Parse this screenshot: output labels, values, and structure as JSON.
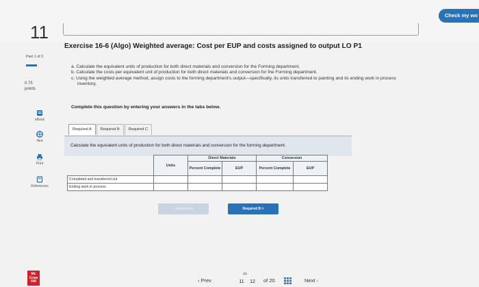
{
  "question": {
    "number": "11"
  },
  "header": {
    "check_button": "Check my wo"
  },
  "sidebar": {
    "part": "Part 1 of 2",
    "points_value": "0.75",
    "points_label": "points",
    "items": [
      {
        "label": "eBook",
        "icon": "book-icon"
      },
      {
        "label": "Hint",
        "icon": "hint-icon"
      },
      {
        "label": "Print",
        "icon": "print-icon"
      },
      {
        "label": "References",
        "icon": "references-icon"
      }
    ],
    "logo": {
      "line1": "Mc",
      "line2": "Graw",
      "line3": "Hill"
    }
  },
  "exercise": {
    "title": "Exercise 16-6 (Algo) Weighted average: Cost per EUP and costs assigned to output LO P1",
    "instructions": [
      {
        "letter": "a.",
        "text": "Calculate the equivalent units of production for both direct materials and conversion for the Forming department."
      },
      {
        "letter": "b.",
        "text": "Calculate the costs per equivalent unit of production for both direct materials and conversion for the Forming department."
      },
      {
        "letter": "c.",
        "text": "Using the weighted average method, assign costs to the forming department's output—specifically, its units transferred to painting and its ending work in process inventory."
      }
    ],
    "complete_note": "Complete this question by entering your answers in the tabs below."
  },
  "tabs": [
    {
      "label": "Required A",
      "active": true
    },
    {
      "label": "Required B",
      "active": false
    },
    {
      "label": "Required C",
      "active": false
    }
  ],
  "panel": {
    "instruction": "Calculate the equivalent units of production for both direct materials and conversion for the forming department."
  },
  "table": {
    "headers": {
      "units": "Units",
      "direct_materials": "Direct Materials",
      "conversion": "Conversion",
      "percent_complete": "Percent Complete",
      "eup": "EUP"
    },
    "rows": [
      {
        "label": "Completed and transferred out"
      },
      {
        "label": "Ending work in process"
      }
    ]
  },
  "navigation": {
    "prev_tab": "< Required A",
    "next_tab": "Required B  >",
    "prev": "Prev",
    "current_page": "11",
    "next_page": "12",
    "total": "of 20",
    "next": "Next"
  }
}
